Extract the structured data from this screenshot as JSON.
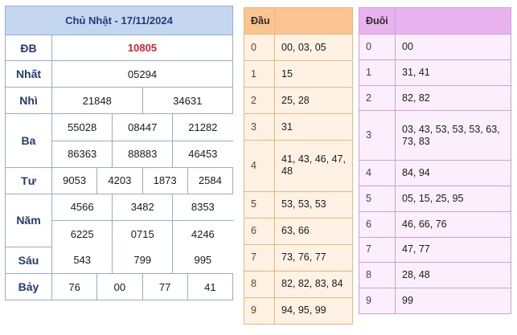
{
  "results": {
    "title": "Chủ Nhật - 17/11/2024",
    "rows": [
      {
        "label": "ĐB",
        "values": [
          "10805"
        ]
      },
      {
        "label": "Nhất",
        "values": [
          "05294"
        ]
      },
      {
        "label": "Nhì",
        "values": [
          "21848",
          "34631"
        ]
      },
      {
        "label": "Ba",
        "values": [
          "55028",
          "08447",
          "21282",
          "86363",
          "88883",
          "46453"
        ]
      },
      {
        "label": "Tư",
        "values": [
          "9053",
          "4203",
          "1873",
          "2584"
        ]
      },
      {
        "label": "Năm",
        "values": [
          "4566",
          "3482",
          "8353",
          "6225",
          "0715",
          "4246"
        ]
      },
      {
        "label": "Sáu",
        "values": [
          "543",
          "799",
          "995"
        ]
      },
      {
        "label": "Bảy",
        "values": [
          "76",
          "00",
          "77",
          "41"
        ]
      }
    ]
  },
  "dau": {
    "header": "Đầu",
    "rows": [
      {
        "key": "0",
        "value": "00, 03, 05"
      },
      {
        "key": "1",
        "value": "15"
      },
      {
        "key": "2",
        "value": "25, 28"
      },
      {
        "key": "3",
        "value": "31"
      },
      {
        "key": "4",
        "value": "41, 43, 46, 47, 48"
      },
      {
        "key": "5",
        "value": "53, 53, 53"
      },
      {
        "key": "6",
        "value": "63, 66"
      },
      {
        "key": "7",
        "value": "73, 76, 77"
      },
      {
        "key": "8",
        "value": "82, 82, 83, 84"
      },
      {
        "key": "9",
        "value": "94, 95, 99"
      }
    ]
  },
  "duoi": {
    "header": "Đuôi",
    "rows": [
      {
        "key": "0",
        "value": "00"
      },
      {
        "key": "1",
        "value": "31, 41"
      },
      {
        "key": "2",
        "value": "82, 82"
      },
      {
        "key": "3",
        "value": "03, 43, 53, 53, 53, 63, 73, 83"
      },
      {
        "key": "4",
        "value": "84, 94"
      },
      {
        "key": "5",
        "value": "05, 15, 25, 95"
      },
      {
        "key": "6",
        "value": "46, 66, 76"
      },
      {
        "key": "7",
        "value": "47, 77"
      },
      {
        "key": "8",
        "value": "28, 48"
      },
      {
        "key": "9",
        "value": "99"
      }
    ]
  }
}
